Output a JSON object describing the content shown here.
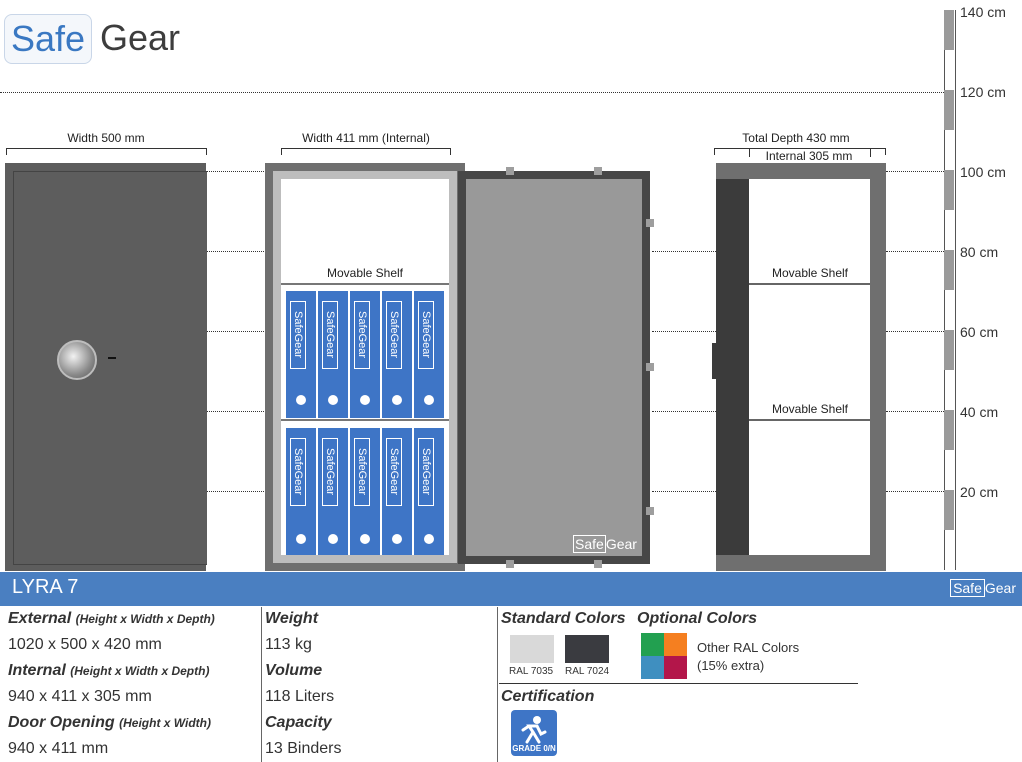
{
  "brand": {
    "part1": "Safe",
    "part2": "Gear"
  },
  "scale": {
    "ticks": [
      "140 cm",
      "120 cm",
      "100 cm",
      "80 cm",
      "60 cm",
      "40 cm",
      "20 cm"
    ]
  },
  "dimensions": {
    "front_width": "Width 500 mm",
    "internal_width": "Width 411 mm (Internal)",
    "total_depth": "Total Depth 430 mm",
    "internal_depth": "Internal 305 mm"
  },
  "shelves": {
    "label": "Movable Shelf"
  },
  "binder": {
    "label": "SafeGear"
  },
  "door_logo": {
    "part1": "Safe",
    "part2": "Gear"
  },
  "model": {
    "name": "LYRA 7"
  },
  "specs": {
    "external": {
      "title": "External",
      "note": "(Height x Width x Depth)",
      "value": "1020 x 500 x 420 mm"
    },
    "internal": {
      "title": "Internal",
      "note": "(Height x Width x Depth)",
      "value": "940 x 411 x 305 mm"
    },
    "door": {
      "title": "Door Opening",
      "note": "(Height x Width)",
      "value": "940 x 411 mm"
    },
    "weight": {
      "title": "Weight",
      "value": "113 kg"
    },
    "volume": {
      "title": "Volume",
      "value": "118 Liters"
    },
    "capacity": {
      "title": "Capacity",
      "value": "13 Binders"
    }
  },
  "colors": {
    "standard_title": "Standard Colors",
    "optional_title": "Optional Colors",
    "standard": [
      {
        "name": "RAL 7035",
        "hex": "#d9d9d9"
      },
      {
        "name": "RAL 7024",
        "hex": "#3a3b40"
      }
    ],
    "optional_text_1": "Other RAL Colors",
    "optional_text_2": "(15% extra)",
    "optional_swatches": [
      "#22a050",
      "#f57f20",
      "#3f8fc0",
      "#b3164a"
    ]
  },
  "certification": {
    "title": "Certification",
    "badge": "GRADE 0/N"
  }
}
